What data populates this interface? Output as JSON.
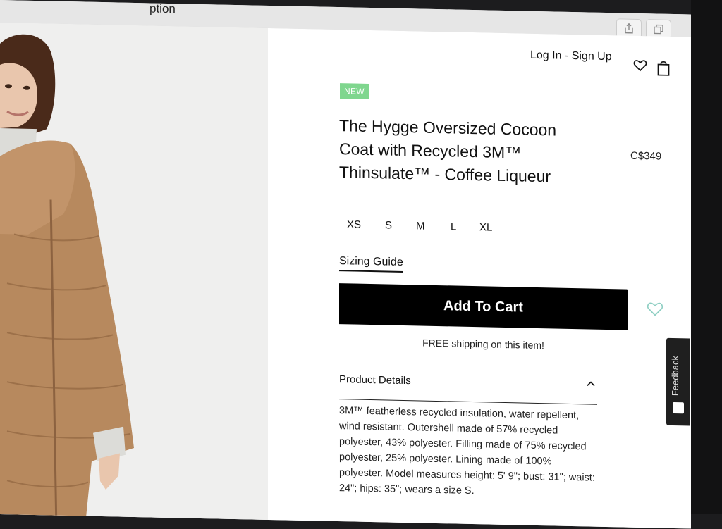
{
  "browser": {
    "tab_title": "ption",
    "share_icon": "share-icon",
    "tabs_icon": "tabs-icon",
    "new_tab_icon": "plus-icon",
    "new_tab_label": "+"
  },
  "header": {
    "login_label": "Log In - Sign Up",
    "wishlist_icon": "heart-icon",
    "cart_icon": "shopping-bag-icon"
  },
  "product": {
    "badge": "NEW",
    "title": "The Hygge Oversized Cocoon Coat with Recycled 3M™ Thinsulate™ - Coffee Liqueur",
    "price": "C$349",
    "sizes": [
      "XS",
      "S",
      "M",
      "L",
      "XL"
    ],
    "sizing_guide_label": "Sizing Guide",
    "add_to_cart_label": "Add To Cart",
    "wishlist_icon": "heart-outline-icon",
    "shipping_note": "FREE shipping on this item!",
    "details": {
      "title": "Product Details",
      "toggle_icon": "chevron-up-icon",
      "body": "3M™ featherless recycled insulation, water repellent, wind resistant. Outershell made of 57% recycled polyester, 43% polyester. Filling made of 75% recycled polyester, 25% polyester. Lining made of 100% polyester. Model measures height: 5' 9\"; bust: 31\"; waist: 24\"; hips: 35\"; wears a size S."
    }
  },
  "feedback": {
    "label": "Feedback",
    "icon": "feedback-icon"
  },
  "colors": {
    "accent_new_badge": "#7fd68e",
    "button_bg": "#000000",
    "wishlist_outline": "#8fcfc3",
    "coat": "#b7895e"
  }
}
